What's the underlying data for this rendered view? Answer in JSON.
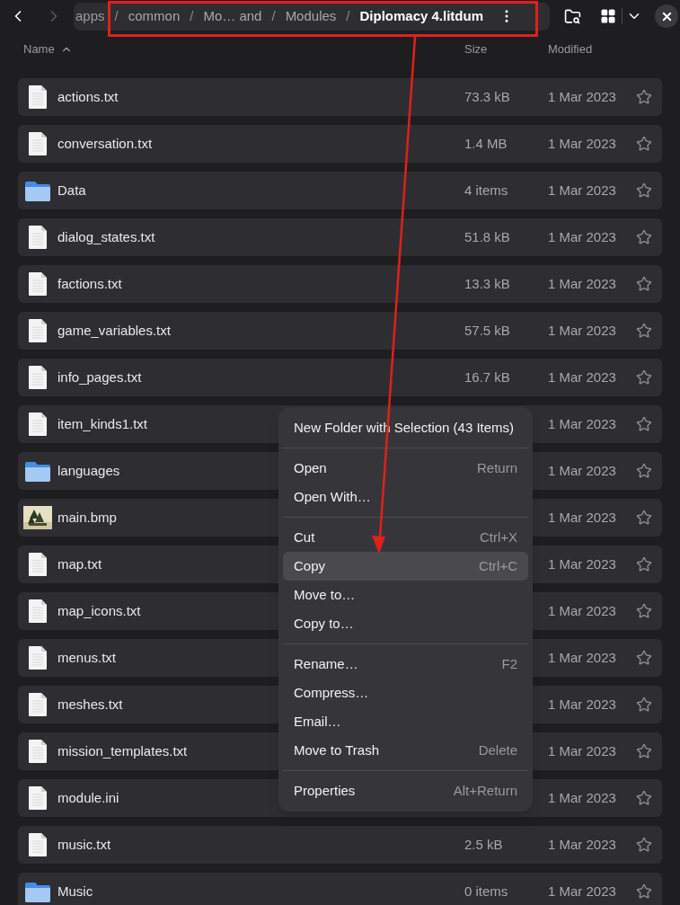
{
  "toolbar": {
    "back_disabled": false,
    "forward_disabled": true
  },
  "path_separator": "/",
  "path": [
    {
      "label": "apps",
      "current": false
    },
    {
      "label": "common",
      "current": false
    },
    {
      "label": "Mo… and",
      "current": false
    },
    {
      "label": "Modules",
      "current": false
    },
    {
      "label": "Diplomacy 4.litdum",
      "current": true
    }
  ],
  "columns": {
    "name": "Name",
    "size": "Size",
    "modified": "Modified"
  },
  "files": [
    {
      "kind": "file",
      "name": "actions.txt",
      "size": "73.3 kB",
      "modified": "1 Mar 2023",
      "starred": false
    },
    {
      "kind": "file",
      "name": "conversation.txt",
      "size": "1.4 MB",
      "modified": "1 Mar 2023",
      "starred": false
    },
    {
      "kind": "folder",
      "name": "Data",
      "size": "4 items",
      "modified": "1 Mar 2023",
      "starred": false
    },
    {
      "kind": "file",
      "name": "dialog_states.txt",
      "size": "51.8 kB",
      "modified": "1 Mar 2023",
      "starred": false
    },
    {
      "kind": "file",
      "name": "factions.txt",
      "size": "13.3 kB",
      "modified": "1 Mar 2023",
      "starred": false
    },
    {
      "kind": "file",
      "name": "game_variables.txt",
      "size": "57.5 kB",
      "modified": "1 Mar 2023",
      "starred": false
    },
    {
      "kind": "file",
      "name": "info_pages.txt",
      "size": "16.7 kB",
      "modified": "1 Mar 2023",
      "starred": false
    },
    {
      "kind": "file",
      "name": "item_kinds1.txt",
      "modified": "1 Mar 2023",
      "starred": false
    },
    {
      "kind": "folder",
      "name": "languages",
      "modified": "1 Mar 2023",
      "starred": false
    },
    {
      "name": "main.bmp",
      "modified": "1 Mar 2023",
      "starred": false
    },
    {
      "kind": "file",
      "name": "map.txt",
      "modified": "1 Mar 2023",
      "starred": false
    },
    {
      "kind": "file",
      "name": "map_icons.txt",
      "modified": "1 Mar 2023",
      "starred": false
    },
    {
      "kind": "file",
      "name": "menus.txt",
      "modified": "1 Mar 2023",
      "starred": false
    },
    {
      "kind": "file",
      "name": "meshes.txt",
      "modified": "1 Mar 2023",
      "starred": false
    },
    {
      "kind": "file",
      "name": "mission_templates.txt",
      "modified": "1 Mar 2023",
      "starred": false
    },
    {
      "kind": "file",
      "name": "module.ini",
      "modified": "1 Mar 2023",
      "starred": false
    },
    {
      "kind": "file",
      "name": "music.txt",
      "size": "2.5 kB",
      "modified": "1 Mar 2023",
      "starred": false
    },
    {
      "kind": "folder",
      "name": "Music",
      "size": "0 items",
      "modified": "1 Mar 2023",
      "starred": false
    }
  ],
  "context_menu": [
    [
      {
        "label": "New Folder with Selection (43 Items)",
        "selected": false
      }
    ],
    [
      {
        "label": "Open",
        "shortcut": "Return",
        "selected": false
      },
      {
        "label": "Open With…",
        "selected": false
      }
    ],
    [
      {
        "label": "Cut",
        "shortcut": "Ctrl+X",
        "selected": false
      },
      {
        "label": "Copy",
        "shortcut": "Ctrl+C",
        "selected": true
      },
      {
        "label": "Move to…",
        "selected": false
      },
      {
        "label": "Copy to…",
        "selected": false
      }
    ],
    [
      {
        "label": "Rename…",
        "shortcut": "F2",
        "selected": false
      },
      {
        "label": "Compress…",
        "selected": false
      },
      {
        "label": "Email…",
        "selected": false
      },
      {
        "label": "Move to Trash",
        "shortcut": "Delete",
        "selected": false
      }
    ],
    [
      {
        "label": "Properties",
        "shortcut": "Alt+Return",
        "selected": false
      }
    ]
  ]
}
